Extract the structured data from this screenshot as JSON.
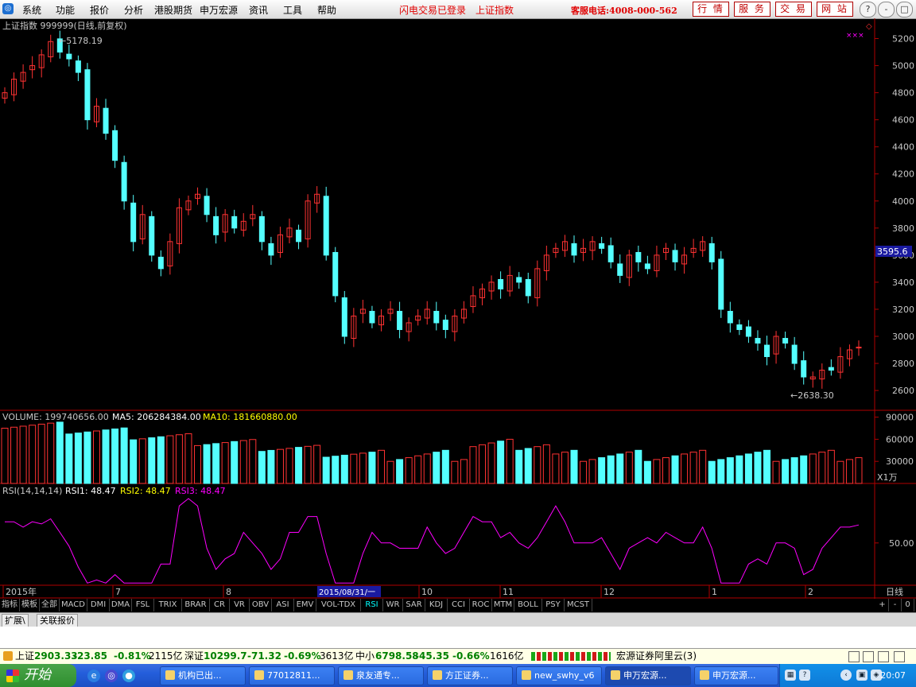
{
  "menubar": {
    "items": [
      "系统",
      "功能",
      "报价",
      "分析",
      "港股期货",
      "申万宏源",
      "资讯",
      "工具",
      "帮助"
    ],
    "status1": "闪电交易已登录",
    "status2": "上证指数",
    "hotline": "客服电话:4008-000-562",
    "nav_buttons": [
      "行 情",
      "服 务",
      "交 易",
      "网 站"
    ],
    "window_buttons": {
      "help": "?",
      "minimize": "-",
      "restore": "□",
      "close": "×"
    }
  },
  "chart_header": "上证指数 999999(日线,前复权)",
  "volume_header": {
    "label": "VOLUME: 199740656.00",
    "ma5": "MA5: 206284384.00",
    "ma10": "MA10: 181660880.00"
  },
  "rsi_header": {
    "label": "RSI(14,14,14)",
    "rsi1": "RSI1: 48.47",
    "rsi2": "RSI2: 48.47",
    "rsi3": "RSI3: 48.47"
  },
  "annotations": {
    "high": "5178.19",
    "low": "2638.30",
    "price_tag": "3595.6",
    "vol_unit": "X1万",
    "corner_mark": "×××"
  },
  "x_axis": {
    "labels": [
      "2015年",
      "7",
      "8",
      "10",
      "11",
      "12",
      "1",
      "2"
    ],
    "cursor_date": "2015/08/31/一",
    "period": "日线",
    "buttons": [
      "+",
      "-",
      "0"
    ]
  },
  "indicator_tabs": [
    "指标",
    "模板",
    "全部",
    "MACD",
    "DMI",
    "DMA",
    "FSL",
    "TRIX",
    "BRAR",
    "CR",
    "VR",
    "OBV",
    "ASI",
    "EMV",
    "VOL-TDX",
    "RSI",
    "WR",
    "SAR",
    "KDJ",
    "CCI",
    "ROC",
    "MTM",
    "BOLL",
    "PSY",
    "MCST"
  ],
  "active_tab": "RSI",
  "sub_tabs": [
    "扩展\\",
    "关联报价"
  ],
  "status_bar": {
    "sh_name": "上证",
    "sh_value": "2903.33",
    "sh_change": "-23.85",
    "sh_pct": "-0.81%",
    "sh_amount": "2115亿",
    "sz_name": "深证",
    "sz_value": "10299.7",
    "sz_change": "-71.32",
    "sz_pct": "-0.69%",
    "sz_amount": "3613亿",
    "zx_name": "中小",
    "zx_value": "6798.58",
    "zx_change": "-45.35",
    "zx_pct": "-0.66%",
    "zx_amount": "1616亿",
    "server": "宏源证券阿里云(3)"
  },
  "taskbar": {
    "start": "开始",
    "tasks": [
      "机构已出...",
      "77012811...",
      "泉友通专...",
      "方正证券...",
      "new_swhy_v6",
      "申万宏源...",
      "申万宏源..."
    ],
    "clock": "20:07"
  },
  "colors": {
    "up": "#ff3232",
    "down": "#54ffff",
    "axis": "#b00000",
    "ma5": "#ffffff",
    "ma10": "#ffff00",
    "rsi": "#ff00ff"
  },
  "chart_data": [
    {
      "type": "candlestick",
      "title": "上证指数 999999(日线,前复权)",
      "y_ticks": [
        2600,
        2800,
        3000,
        3200,
        3400,
        3600,
        3800,
        4000,
        4200,
        4400,
        4600,
        4800,
        5000,
        5200
      ],
      "ylim": [
        2530,
        5250
      ],
      "x_ticks": [
        "2015年",
        "7",
        "8",
        "10",
        "11",
        "12",
        "1",
        "2"
      ],
      "max_label": 5178.19,
      "min_label": 2638.3,
      "last_price_label": 3595.6,
      "close": [
        4800,
        4900,
        4950,
        5000,
        5080,
        5178,
        5100,
        5050,
        4950,
        4600,
        4700,
        4500,
        4300,
        4000,
        3700,
        3900,
        3600,
        3500,
        3700,
        3950,
        4000,
        4050,
        3900,
        3750,
        3900,
        3800,
        3850,
        3900,
        3700,
        3600,
        3750,
        3800,
        3700,
        4000,
        4050,
        3600,
        3300,
        3000,
        3150,
        3200,
        3100,
        3150,
        3200,
        3050,
        3100,
        3150,
        3200,
        3100,
        3050,
        3150,
        3200,
        3300,
        3350,
        3400,
        3350,
        3450,
        3400,
        3300,
        3500,
        3600,
        3650,
        3700,
        3600,
        3650,
        3700,
        3650,
        3550,
        3450,
        3600,
        3550,
        3500,
        3600,
        3650,
        3550,
        3600,
        3650,
        3700,
        3550,
        3200,
        3100,
        3050,
        3000,
        2950,
        2850,
        3000,
        2950,
        2800,
        2700,
        2700,
        2750,
        2750,
        2850,
        2900,
        2920
      ],
      "volume_scale": "X1万",
      "volume_ticks": [
        30000,
        60000,
        90000
      ],
      "rsi_ticks": [
        50.0
      ],
      "rsi_last": 48.47
    }
  ]
}
